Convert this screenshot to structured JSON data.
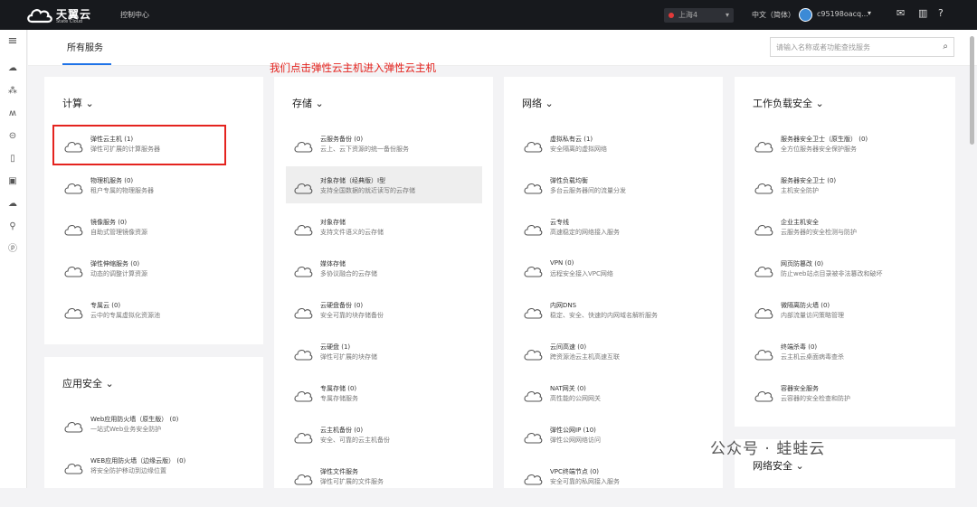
{
  "topbar": {
    "logo_cn": "天翼云",
    "logo_en": "State Cloud",
    "console": "控制中心",
    "region": "上海4",
    "language": "中文（简体）",
    "user": "c95198oacq...",
    "colors": {
      "bar": "#17191d",
      "accent": "#1f73e8",
      "annotation": "#e4231e"
    }
  },
  "main": {
    "tab": "所有服务",
    "search_placeholder": "请输入名称或者功能查找服务",
    "annotation": "我们点击弹性云主机进入弹性云主机",
    "watermark": "公众号 · 蛙蛙云"
  },
  "columns": [
    {
      "title": "计算",
      "services": [
        {
          "name": "弹性云主机 (1)",
          "desc": "弹性可扩展的计算服务器",
          "icon": "cloud-server-icon"
        },
        {
          "name": "物理机服务 (0)",
          "desc": "租户专属的物理服务器",
          "icon": "bare-metal-icon"
        },
        {
          "name": "镜像服务 (0)",
          "desc": "自助式管理镜像资源",
          "icon": "image-icon"
        },
        {
          "name": "弹性伸缩服务 (0)",
          "desc": "动态的调整计算资源",
          "icon": "autoscale-icon"
        },
        {
          "name": "专属云 (0)",
          "desc": "云中的专属虚拟化资源池",
          "icon": "dedicated-cloud-icon"
        }
      ]
    },
    {
      "title": "存储",
      "services": [
        {
          "name": "云服务备份 (0)",
          "desc": "云上、云下资源的统一备份服务",
          "icon": "cloud-backup-icon"
        },
        {
          "name": "对象存储（经典版）Ⅰ型",
          "desc": "支持全国数据的就近读写的云存储",
          "icon": "object-storage-icon"
        },
        {
          "name": "对象存储",
          "desc": "支持文件语义的云存储",
          "icon": "object-storage2-icon"
        },
        {
          "name": "媒体存储",
          "desc": "多协议融合的云存储",
          "icon": "media-storage-icon"
        },
        {
          "name": "云硬盘备份 (0)",
          "desc": "安全可靠的块存储备份",
          "icon": "disk-backup-icon"
        },
        {
          "name": "云硬盘 (1)",
          "desc": "弹性可扩展的块存储",
          "icon": "cloud-disk-icon"
        },
        {
          "name": "专属存储 (0)",
          "desc": "专属存储服务",
          "icon": "dedicated-storage-icon"
        },
        {
          "name": "云主机备份 (0)",
          "desc": "安全、可靠的云主机备份",
          "icon": "server-backup-icon"
        },
        {
          "name": "弹性文件服务",
          "desc": "弹性可扩展的文件服务",
          "icon": "file-service-icon"
        }
      ]
    },
    {
      "title": "网络",
      "services": [
        {
          "name": "虚拟私有云 (1)",
          "desc": "安全隔离的虚拟网络",
          "icon": "vpc-icon"
        },
        {
          "name": "弹性负载均衡",
          "desc": "多台云服务器间的流量分发",
          "icon": "load-balancer-icon"
        },
        {
          "name": "云专线",
          "desc": "高速稳定的网络接入服务",
          "icon": "direct-connect-icon"
        },
        {
          "name": "VPN (0)",
          "desc": "远程安全接入VPC网络",
          "icon": "vpn-icon"
        },
        {
          "name": "内网DNS",
          "desc": "稳定、安全、快速的内网域名解析服务",
          "icon": "dns-icon"
        },
        {
          "name": "云间高速 (0)",
          "desc": "跨资源池云主机高速互联",
          "icon": "cloud-connect-icon"
        },
        {
          "name": "NAT网关 (0)",
          "desc": "高性能的公网网关",
          "icon": "nat-icon"
        },
        {
          "name": "弹性公网IP (10)",
          "desc": "弹性公网网络访问",
          "icon": "eip-icon"
        },
        {
          "name": "VPC终端节点 (0)",
          "desc": "安全可靠的私网接入服务",
          "icon": "endpoint-icon"
        }
      ]
    },
    {
      "title": "工作负载安全",
      "services": [
        {
          "name": "服务器安全卫士（原生版） (0)",
          "desc": "全方位服务器安全保护服务",
          "icon": "server-guard-icon"
        },
        {
          "name": "服务器安全卫士 (0)",
          "desc": "主机安全防护",
          "icon": "host-guard-icon"
        },
        {
          "name": "企业主机安全",
          "desc": "云服务器的安全检测与防护",
          "icon": "enterprise-host-icon"
        },
        {
          "name": "网页防篡改 (0)",
          "desc": "防止web站点目录被非法篡改和破坏",
          "icon": "web-tamper-icon"
        },
        {
          "name": "微隔离防火墙 (0)",
          "desc": "内部流量访问策略管理",
          "icon": "micro-firewall-icon"
        },
        {
          "name": "终端杀毒 (0)",
          "desc": "云主机云桌面病毒查杀",
          "icon": "antivirus-icon"
        },
        {
          "name": "容器安全服务",
          "desc": "云容器的安全检查和防护",
          "icon": "container-security-icon"
        }
      ]
    }
  ],
  "app_security": {
    "title": "应用安全",
    "services": [
      {
        "name": "Web应用防火墙（原生版） (0)",
        "desc": "一站式Web业务安全防护",
        "icon": "waf-icon"
      },
      {
        "name": "WEB应用防火墙（边缘云版） (0)",
        "desc": "将安全防护移动到边缘位置",
        "icon": "edge-waf-icon"
      }
    ]
  },
  "net_security": {
    "title": "网络安全"
  }
}
